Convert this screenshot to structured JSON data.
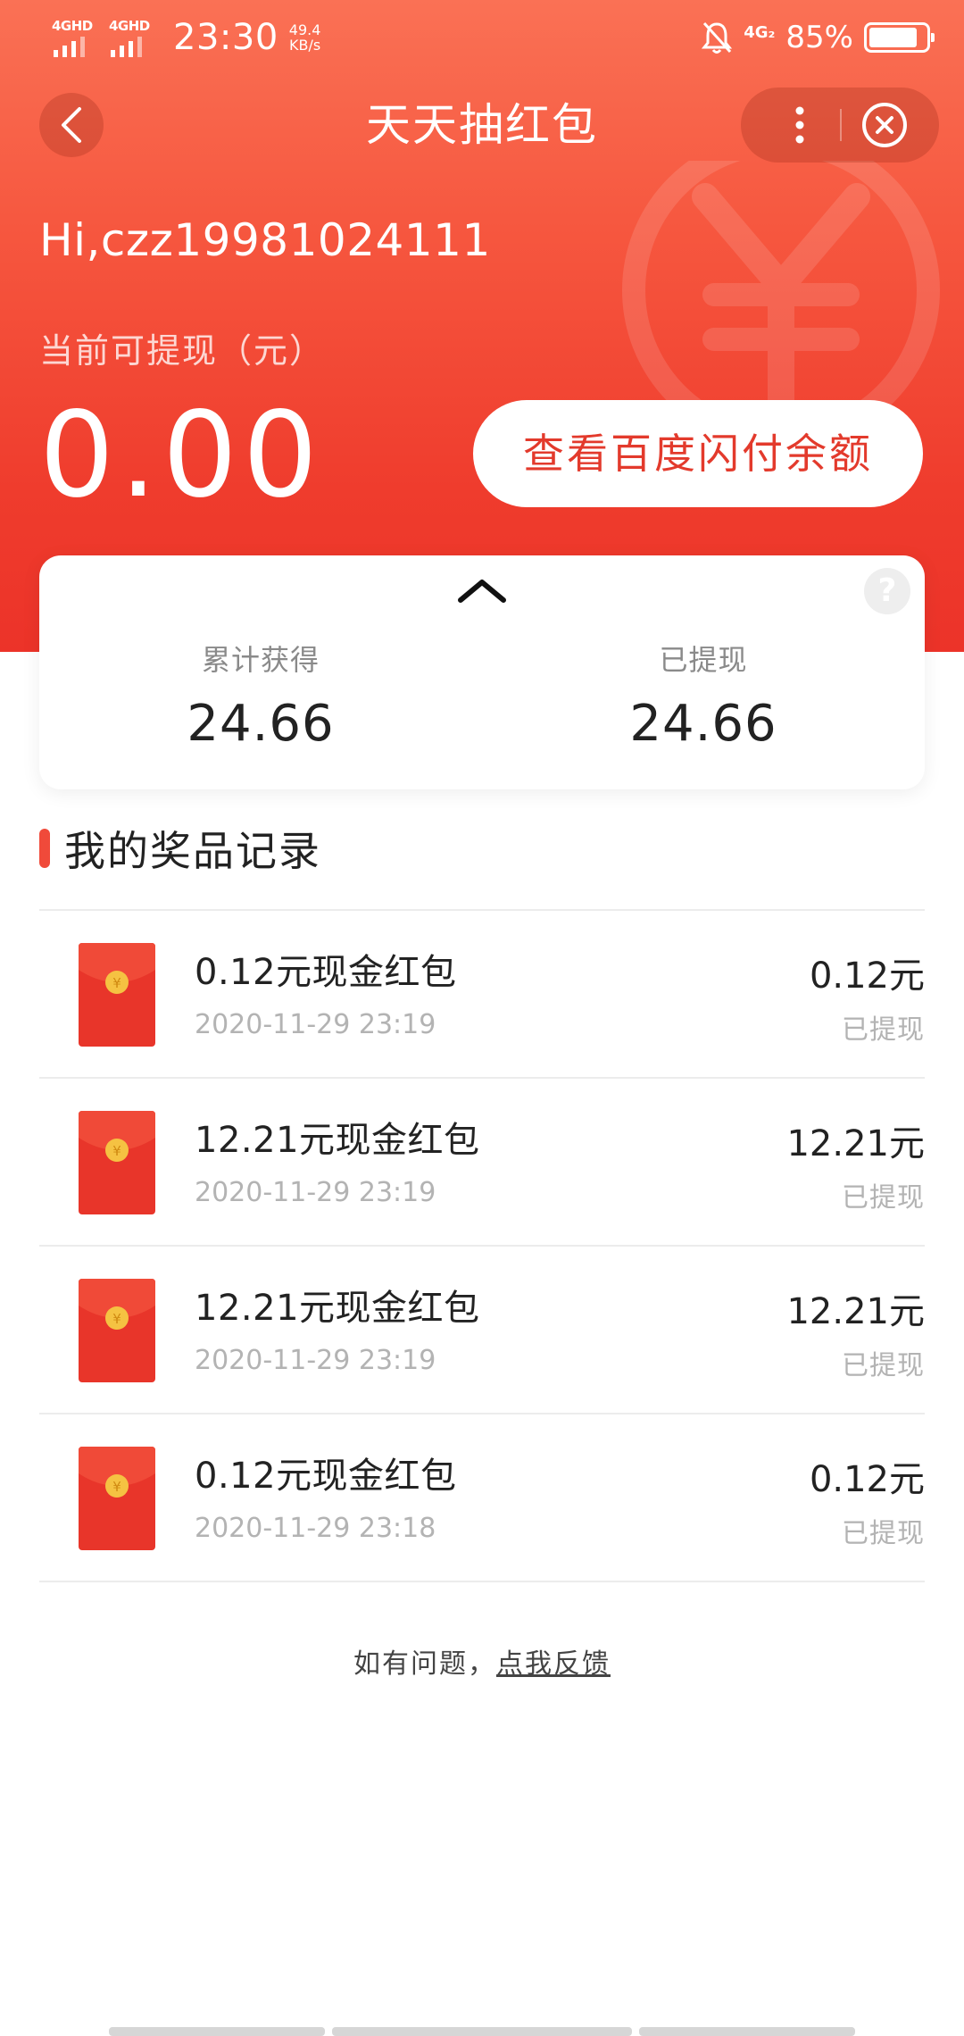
{
  "status_bar": {
    "signal1": "4GHD",
    "signal2": "4GHD",
    "time": "23:30",
    "speed_value": "49.4",
    "speed_unit": "KB/s",
    "network": "4G₂",
    "battery": "85%",
    "battery_level": 0.85
  },
  "nav": {
    "title": "天天抽红包"
  },
  "hero": {
    "greeting": "Hi,czz19981024111",
    "available_label": "当前可提现（元）",
    "balance": "0.00",
    "view_button": "查看百度闪付余额"
  },
  "stats": {
    "total_label": "累计获得",
    "total_value": "24.66",
    "withdrawn_label": "已提现",
    "withdrawn_value": "24.66",
    "help": "?"
  },
  "section": {
    "title": "我的奖品记录"
  },
  "records": [
    {
      "name": "0.12元现金红包",
      "time": "2020-11-29 23:19",
      "amount": "0.12元",
      "status": "已提现"
    },
    {
      "name": "12.21元现金红包",
      "time": "2020-11-29 23:19",
      "amount": "12.21元",
      "status": "已提现"
    },
    {
      "name": "12.21元现金红包",
      "time": "2020-11-29 23:19",
      "amount": "12.21元",
      "status": "已提现"
    },
    {
      "name": "0.12元现金红包",
      "time": "2020-11-29 23:18",
      "amount": "0.12元",
      "status": "已提现"
    }
  ],
  "feedback": {
    "prefix": "如有问题，",
    "link": "点我反馈"
  },
  "colors": {
    "accent": "#ef3c2d",
    "hero_top": "#fa7155",
    "envelope": "#e8352a",
    "coin": "#f5c242"
  },
  "icons": [
    "back-icon",
    "more-icon",
    "close-icon",
    "yuan-watermark-icon",
    "chevron-up-icon",
    "help-icon",
    "red-envelope-icon",
    "coin-icon"
  ]
}
